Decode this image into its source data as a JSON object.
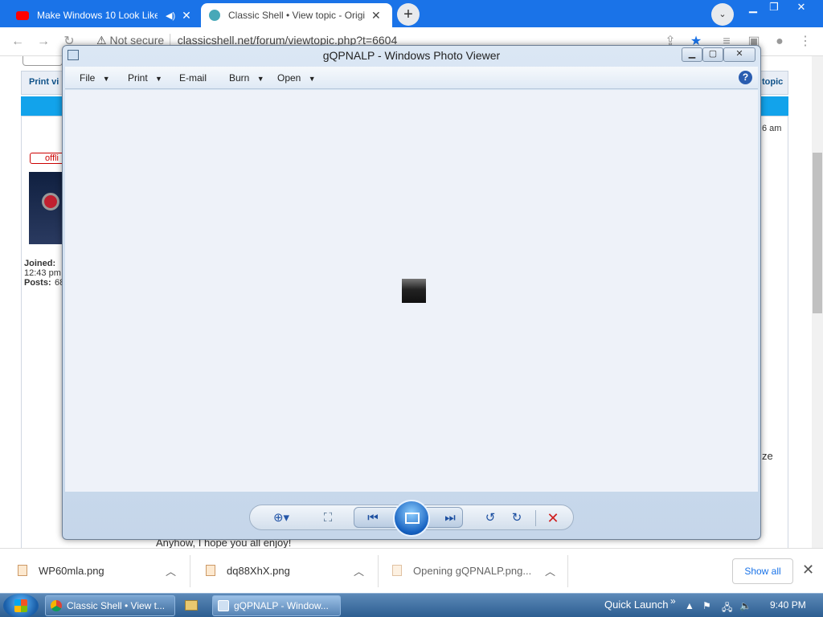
{
  "browser": {
    "tabs": [
      {
        "title": "Make Windows 10 Look Like",
        "icon": "youtube-icon"
      },
      {
        "title": "Classic Shell • View topic - Origin",
        "icon": "classicshell-icon"
      }
    ],
    "address": {
      "security": "Not secure",
      "url": "classicshell.net/forum/viewtopic.php?t=6604"
    }
  },
  "page": {
    "print_view": "Print vi",
    "topic_link": "topic",
    "time_fragment": "6 am",
    "offline_badge": "offli",
    "joined_label": "Joined:",
    "joined_time": "12:43 pm",
    "posts_label": "Posts:",
    "posts_value": "68",
    "side_fragment": "ze",
    "bottom_text": "Anyhow, I hope you all enjoy!"
  },
  "photo_viewer": {
    "title": "gQPNALP - Windows Photo Viewer",
    "menu": {
      "file": "File",
      "print": "Print",
      "email": "E-mail",
      "burn": "Burn",
      "open": "Open"
    },
    "help_icon": "?"
  },
  "downloads": [
    {
      "name": "WP60mla.png"
    },
    {
      "name": "dq88XhX.png"
    },
    {
      "name": "Opening gQPNALP.png..."
    }
  ],
  "downloads_show_all": "Show all",
  "taskbar": {
    "buttons": [
      {
        "label": "Classic Shell • View t..."
      },
      {
        "label": "gQPNALP - Window..."
      }
    ],
    "quick_launch": "Quick Launch",
    "clock": "9:40 PM"
  }
}
